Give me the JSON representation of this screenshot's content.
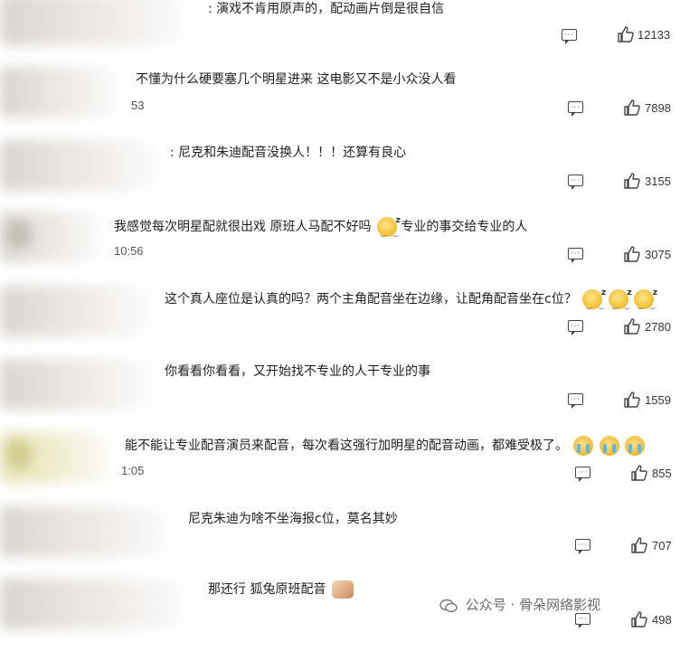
{
  "comments": [
    {
      "text": ": 演戏不肯用原声的，配动画片倒是很自信",
      "meta": "",
      "likes": "12133"
    },
    {
      "text": "不懂为什么硬要塞几个明星进来 这电影又不是小众没人看",
      "meta": "53",
      "likes": "7898"
    },
    {
      "text": ": 尼克和朱迪配音没换人！！！还算有良心",
      "meta": "",
      "likes": "3155"
    },
    {
      "text": "我感觉每次明星配就很出戏 原班人马配不好吗",
      "text_after": "专业的事交给专业的人",
      "meta": "10:56",
      "likes": "3075"
    },
    {
      "text": "这个真人座位是认真的吗？两个主角配音坐在边缘，让配角配音坐在c位？",
      "meta": "",
      "likes": "2780"
    },
    {
      "text": "你看看你看看，又开始找不专业的人干专业的事",
      "meta": "",
      "likes": "1559"
    },
    {
      "text": "能不能让专业配音演员来配音，每次看这强行加明星的配音动画，都难受极了。",
      "meta": "1:05",
      "likes": "855"
    },
    {
      "text": "尼克朱迪为啥不坐海报c位，莫名其妙",
      "meta": "",
      "likes": "707"
    },
    {
      "text": "那还行 狐兔原班配音",
      "meta": "",
      "likes": "498"
    }
  ],
  "icons": {
    "reply": "comment-icon",
    "like": "thumbs-up-icon"
  },
  "watermark": {
    "text": "公众号 · 骨朵网络影视"
  },
  "colors": {
    "text": "#1e1e1e",
    "meta": "#555555",
    "icon": "#444444"
  }
}
